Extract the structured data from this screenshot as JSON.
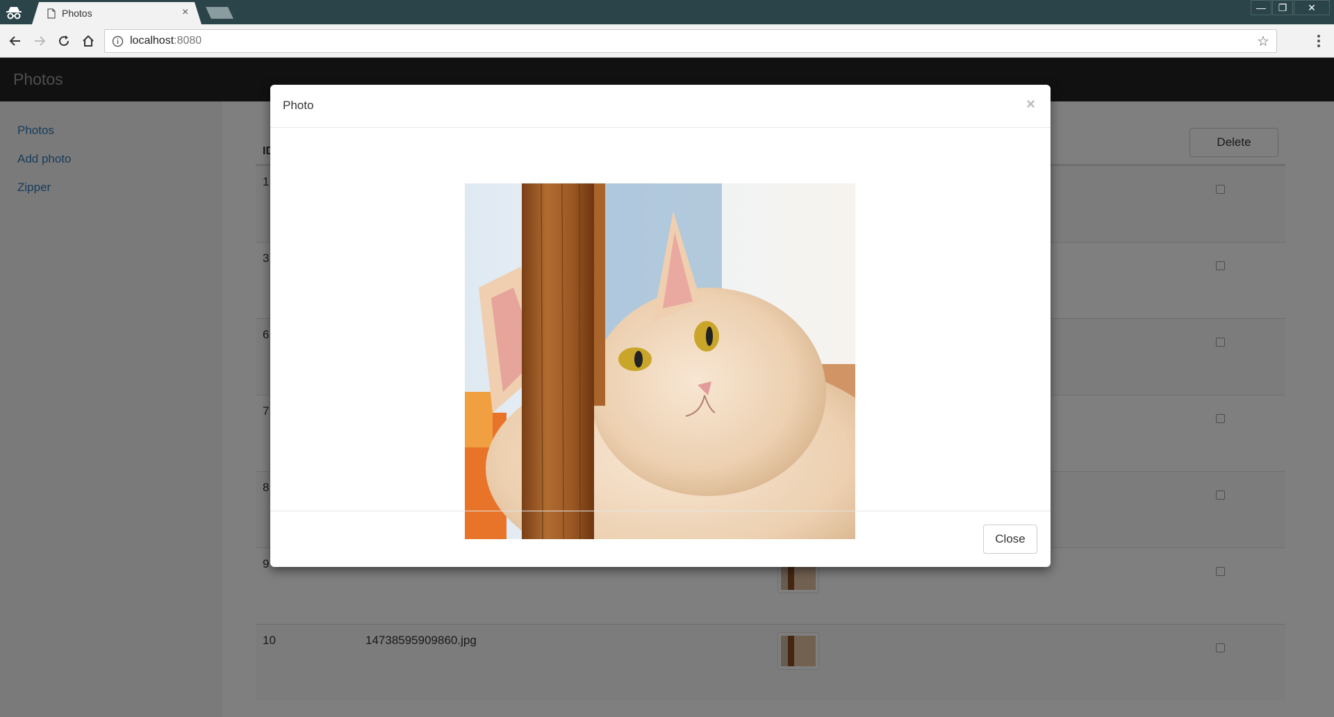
{
  "browser": {
    "tab_title": "Photos",
    "tab_close": "×",
    "url_host": "localhost",
    "url_port": ":8080",
    "window_controls": {
      "minimize": "—",
      "restore": "❐",
      "close": "✕"
    },
    "icons": [
      "incognito-icon",
      "document-icon",
      "back-icon",
      "forward-icon",
      "reload-icon",
      "home-icon",
      "info-icon",
      "star-icon",
      "menu-icon"
    ]
  },
  "app": {
    "brand": "Photos",
    "sidebar": {
      "items": [
        {
          "label": "Photos"
        },
        {
          "label": "Add photo"
        },
        {
          "label": "Zipper"
        }
      ]
    },
    "table": {
      "header_id": "ID",
      "delete_label": "Delete",
      "rows": [
        {
          "id": "1",
          "file": ""
        },
        {
          "id": "3",
          "file": ""
        },
        {
          "id": "6",
          "file": ""
        },
        {
          "id": "7",
          "file": ""
        },
        {
          "id": "8",
          "file": ""
        },
        {
          "id": "9",
          "file": ""
        },
        {
          "id": "10",
          "file": "14738595909860.jpg"
        }
      ]
    }
  },
  "modal": {
    "title": "Photo",
    "close_x": "×",
    "close_label": "Close",
    "photo_subject": "cat-photo"
  },
  "colors": {
    "titlebar": "#2a4449",
    "navbar": "#222222",
    "link": "#337ab7"
  }
}
